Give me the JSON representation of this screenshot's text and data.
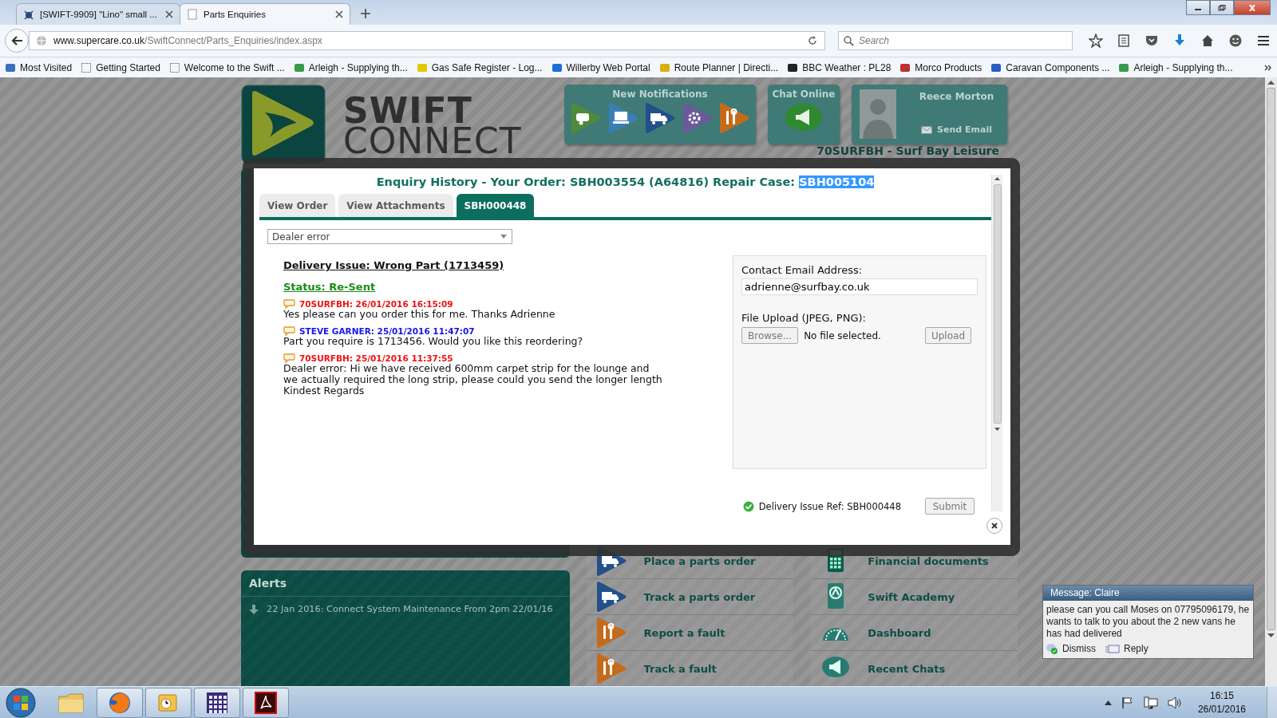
{
  "browser": {
    "tabs": [
      {
        "title": "[SWIFT-9909] \"Lino\" small ...",
        "selected": false
      },
      {
        "title": "Parts Enquiries",
        "selected": true
      }
    ],
    "address": {
      "host": "www.supercare.co.uk",
      "path": "/SwiftConnect/Parts_Enquiries/index.aspx"
    },
    "search": {
      "placeholder": "Search"
    },
    "bookmarks": [
      "Most Visited",
      "Getting Started",
      "Welcome to the Swift ...",
      "Arleigh - Supplying th...",
      "Gas Safe Register - Log...",
      "Willerby Web Portal",
      "Route Planner | Directi...",
      "BBC Weather : PL28",
      "Morco Products",
      "Caravan Components ...",
      "Arleigh - Supplying th..."
    ]
  },
  "header": {
    "logo_lines": [
      "SWIFT",
      "CONNECT"
    ],
    "notifications_title": "New Notifications",
    "chat_title": "Chat Online",
    "user": {
      "name": "Reece Morton",
      "action": "Send Email"
    },
    "dealer": "70SURFBH - Surf Bay Leisure"
  },
  "modal": {
    "title": "Enquiry History - Your Order: SBH003554 (A64816) Repair Case: ",
    "case_ref": {
      "text": "SBH005104",
      "highlighted": true
    },
    "tabs": [
      {
        "label": "View Order",
        "selected": false
      },
      {
        "label": "View Attachments",
        "selected": false
      },
      {
        "label": "SBH000448",
        "selected": true
      }
    ],
    "reason": {
      "value": "Dealer error"
    },
    "issue_title": "Delivery Issue: Wrong Part (1713459)",
    "status": "Status: Re-Sent",
    "messages": [
      {
        "kind": "dealer",
        "author": "70SURFBH: 26/01/2016 16:15:09",
        "text": "Yes please can you order this for me. Thanks Adrienne"
      },
      {
        "kind": "staff",
        "author": "STEVE GARNER: 25/01/2016 11:47:07",
        "text": "Part you require is 1713456. Would you like this reordering?"
      },
      {
        "kind": "dealer",
        "author": "70SURFBH: 25/01/2016 11:37:55",
        "text": "Dealer error: Hi we have received 600mm carpet strip for the lounge and we actually required the long strip, please could you send the longer length Kindest Regards"
      }
    ],
    "contact_label": "Contact Email Address:",
    "contact_email": "adrienne@surfbay.co.uk",
    "upload_label": "File Upload (JPEG, PNG):",
    "browse": "Browse...",
    "file_status": "No file selected.",
    "upload": "Upload",
    "ref": "Delivery Issue Ref: SBH000448",
    "submit": "Submit"
  },
  "alerts": {
    "title": "Alerts",
    "items": [
      "22 Jan 2016: Connect System Maintenance From 2pm 22/01/16"
    ]
  },
  "links_middle": [
    {
      "kind": "truck",
      "label": "Place a parts order"
    },
    {
      "kind": "truck",
      "label": "Track a parts order"
    },
    {
      "kind": "tools",
      "label": "Report a fault"
    },
    {
      "kind": "tools",
      "label": "Track a fault"
    }
  ],
  "links_right": [
    {
      "kind": "calculator",
      "label": "Financial documents"
    },
    {
      "kind": "academy",
      "label": "Swift Academy"
    },
    {
      "kind": "gauge",
      "label": "Dashboard"
    },
    {
      "kind": "chat",
      "label": "Recent Chats"
    }
  ],
  "message": {
    "title": "Message: Claire",
    "text": "please can you call Moses on 07795096179, he wants to talk to you about the 2 new vans he has had delivered",
    "dismiss": "Dismiss",
    "reply": "Reply"
  },
  "taskbar": {
    "time": "16:15",
    "date": "26/01/2016"
  }
}
